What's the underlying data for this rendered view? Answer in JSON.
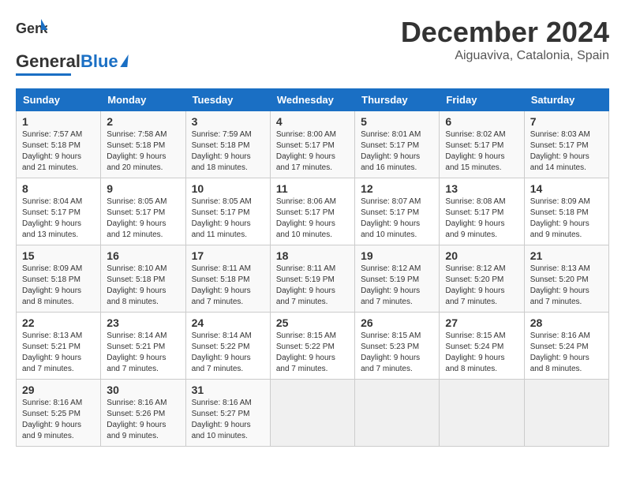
{
  "header": {
    "logo_general": "General",
    "logo_blue": "Blue",
    "title": "December 2024",
    "subtitle": "Aiguaviva, Catalonia, Spain"
  },
  "weekdays": [
    "Sunday",
    "Monday",
    "Tuesday",
    "Wednesday",
    "Thursday",
    "Friday",
    "Saturday"
  ],
  "weeks": [
    [
      {
        "day": "1",
        "sunrise": "Sunrise: 7:57 AM",
        "sunset": "Sunset: 5:18 PM",
        "daylight": "Daylight: 9 hours and 21 minutes."
      },
      {
        "day": "2",
        "sunrise": "Sunrise: 7:58 AM",
        "sunset": "Sunset: 5:18 PM",
        "daylight": "Daylight: 9 hours and 20 minutes."
      },
      {
        "day": "3",
        "sunrise": "Sunrise: 7:59 AM",
        "sunset": "Sunset: 5:18 PM",
        "daylight": "Daylight: 9 hours and 18 minutes."
      },
      {
        "day": "4",
        "sunrise": "Sunrise: 8:00 AM",
        "sunset": "Sunset: 5:17 PM",
        "daylight": "Daylight: 9 hours and 17 minutes."
      },
      {
        "day": "5",
        "sunrise": "Sunrise: 8:01 AM",
        "sunset": "Sunset: 5:17 PM",
        "daylight": "Daylight: 9 hours and 16 minutes."
      },
      {
        "day": "6",
        "sunrise": "Sunrise: 8:02 AM",
        "sunset": "Sunset: 5:17 PM",
        "daylight": "Daylight: 9 hours and 15 minutes."
      },
      {
        "day": "7",
        "sunrise": "Sunrise: 8:03 AM",
        "sunset": "Sunset: 5:17 PM",
        "daylight": "Daylight: 9 hours and 14 minutes."
      }
    ],
    [
      {
        "day": "8",
        "sunrise": "Sunrise: 8:04 AM",
        "sunset": "Sunset: 5:17 PM",
        "daylight": "Daylight: 9 hours and 13 minutes."
      },
      {
        "day": "9",
        "sunrise": "Sunrise: 8:05 AM",
        "sunset": "Sunset: 5:17 PM",
        "daylight": "Daylight: 9 hours and 12 minutes."
      },
      {
        "day": "10",
        "sunrise": "Sunrise: 8:05 AM",
        "sunset": "Sunset: 5:17 PM",
        "daylight": "Daylight: 9 hours and 11 minutes."
      },
      {
        "day": "11",
        "sunrise": "Sunrise: 8:06 AM",
        "sunset": "Sunset: 5:17 PM",
        "daylight": "Daylight: 9 hours and 10 minutes."
      },
      {
        "day": "12",
        "sunrise": "Sunrise: 8:07 AM",
        "sunset": "Sunset: 5:17 PM",
        "daylight": "Daylight: 9 hours and 10 minutes."
      },
      {
        "day": "13",
        "sunrise": "Sunrise: 8:08 AM",
        "sunset": "Sunset: 5:17 PM",
        "daylight": "Daylight: 9 hours and 9 minutes."
      },
      {
        "day": "14",
        "sunrise": "Sunrise: 8:09 AM",
        "sunset": "Sunset: 5:18 PM",
        "daylight": "Daylight: 9 hours and 9 minutes."
      }
    ],
    [
      {
        "day": "15",
        "sunrise": "Sunrise: 8:09 AM",
        "sunset": "Sunset: 5:18 PM",
        "daylight": "Daylight: 9 hours and 8 minutes."
      },
      {
        "day": "16",
        "sunrise": "Sunrise: 8:10 AM",
        "sunset": "Sunset: 5:18 PM",
        "daylight": "Daylight: 9 hours and 8 minutes."
      },
      {
        "day": "17",
        "sunrise": "Sunrise: 8:11 AM",
        "sunset": "Sunset: 5:18 PM",
        "daylight": "Daylight: 9 hours and 7 minutes."
      },
      {
        "day": "18",
        "sunrise": "Sunrise: 8:11 AM",
        "sunset": "Sunset: 5:19 PM",
        "daylight": "Daylight: 9 hours and 7 minutes."
      },
      {
        "day": "19",
        "sunrise": "Sunrise: 8:12 AM",
        "sunset": "Sunset: 5:19 PM",
        "daylight": "Daylight: 9 hours and 7 minutes."
      },
      {
        "day": "20",
        "sunrise": "Sunrise: 8:12 AM",
        "sunset": "Sunset: 5:20 PM",
        "daylight": "Daylight: 9 hours and 7 minutes."
      },
      {
        "day": "21",
        "sunrise": "Sunrise: 8:13 AM",
        "sunset": "Sunset: 5:20 PM",
        "daylight": "Daylight: 9 hours and 7 minutes."
      }
    ],
    [
      {
        "day": "22",
        "sunrise": "Sunrise: 8:13 AM",
        "sunset": "Sunset: 5:21 PM",
        "daylight": "Daylight: 9 hours and 7 minutes."
      },
      {
        "day": "23",
        "sunrise": "Sunrise: 8:14 AM",
        "sunset": "Sunset: 5:21 PM",
        "daylight": "Daylight: 9 hours and 7 minutes."
      },
      {
        "day": "24",
        "sunrise": "Sunrise: 8:14 AM",
        "sunset": "Sunset: 5:22 PM",
        "daylight": "Daylight: 9 hours and 7 minutes."
      },
      {
        "day": "25",
        "sunrise": "Sunrise: 8:15 AM",
        "sunset": "Sunset: 5:22 PM",
        "daylight": "Daylight: 9 hours and 7 minutes."
      },
      {
        "day": "26",
        "sunrise": "Sunrise: 8:15 AM",
        "sunset": "Sunset: 5:23 PM",
        "daylight": "Daylight: 9 hours and 7 minutes."
      },
      {
        "day": "27",
        "sunrise": "Sunrise: 8:15 AM",
        "sunset": "Sunset: 5:24 PM",
        "daylight": "Daylight: 9 hours and 8 minutes."
      },
      {
        "day": "28",
        "sunrise": "Sunrise: 8:16 AM",
        "sunset": "Sunset: 5:24 PM",
        "daylight": "Daylight: 9 hours and 8 minutes."
      }
    ],
    [
      {
        "day": "29",
        "sunrise": "Sunrise: 8:16 AM",
        "sunset": "Sunset: 5:25 PM",
        "daylight": "Daylight: 9 hours and 9 minutes."
      },
      {
        "day": "30",
        "sunrise": "Sunrise: 8:16 AM",
        "sunset": "Sunset: 5:26 PM",
        "daylight": "Daylight: 9 hours and 9 minutes."
      },
      {
        "day": "31",
        "sunrise": "Sunrise: 8:16 AM",
        "sunset": "Sunset: 5:27 PM",
        "daylight": "Daylight: 9 hours and 10 minutes."
      },
      null,
      null,
      null,
      null
    ]
  ]
}
